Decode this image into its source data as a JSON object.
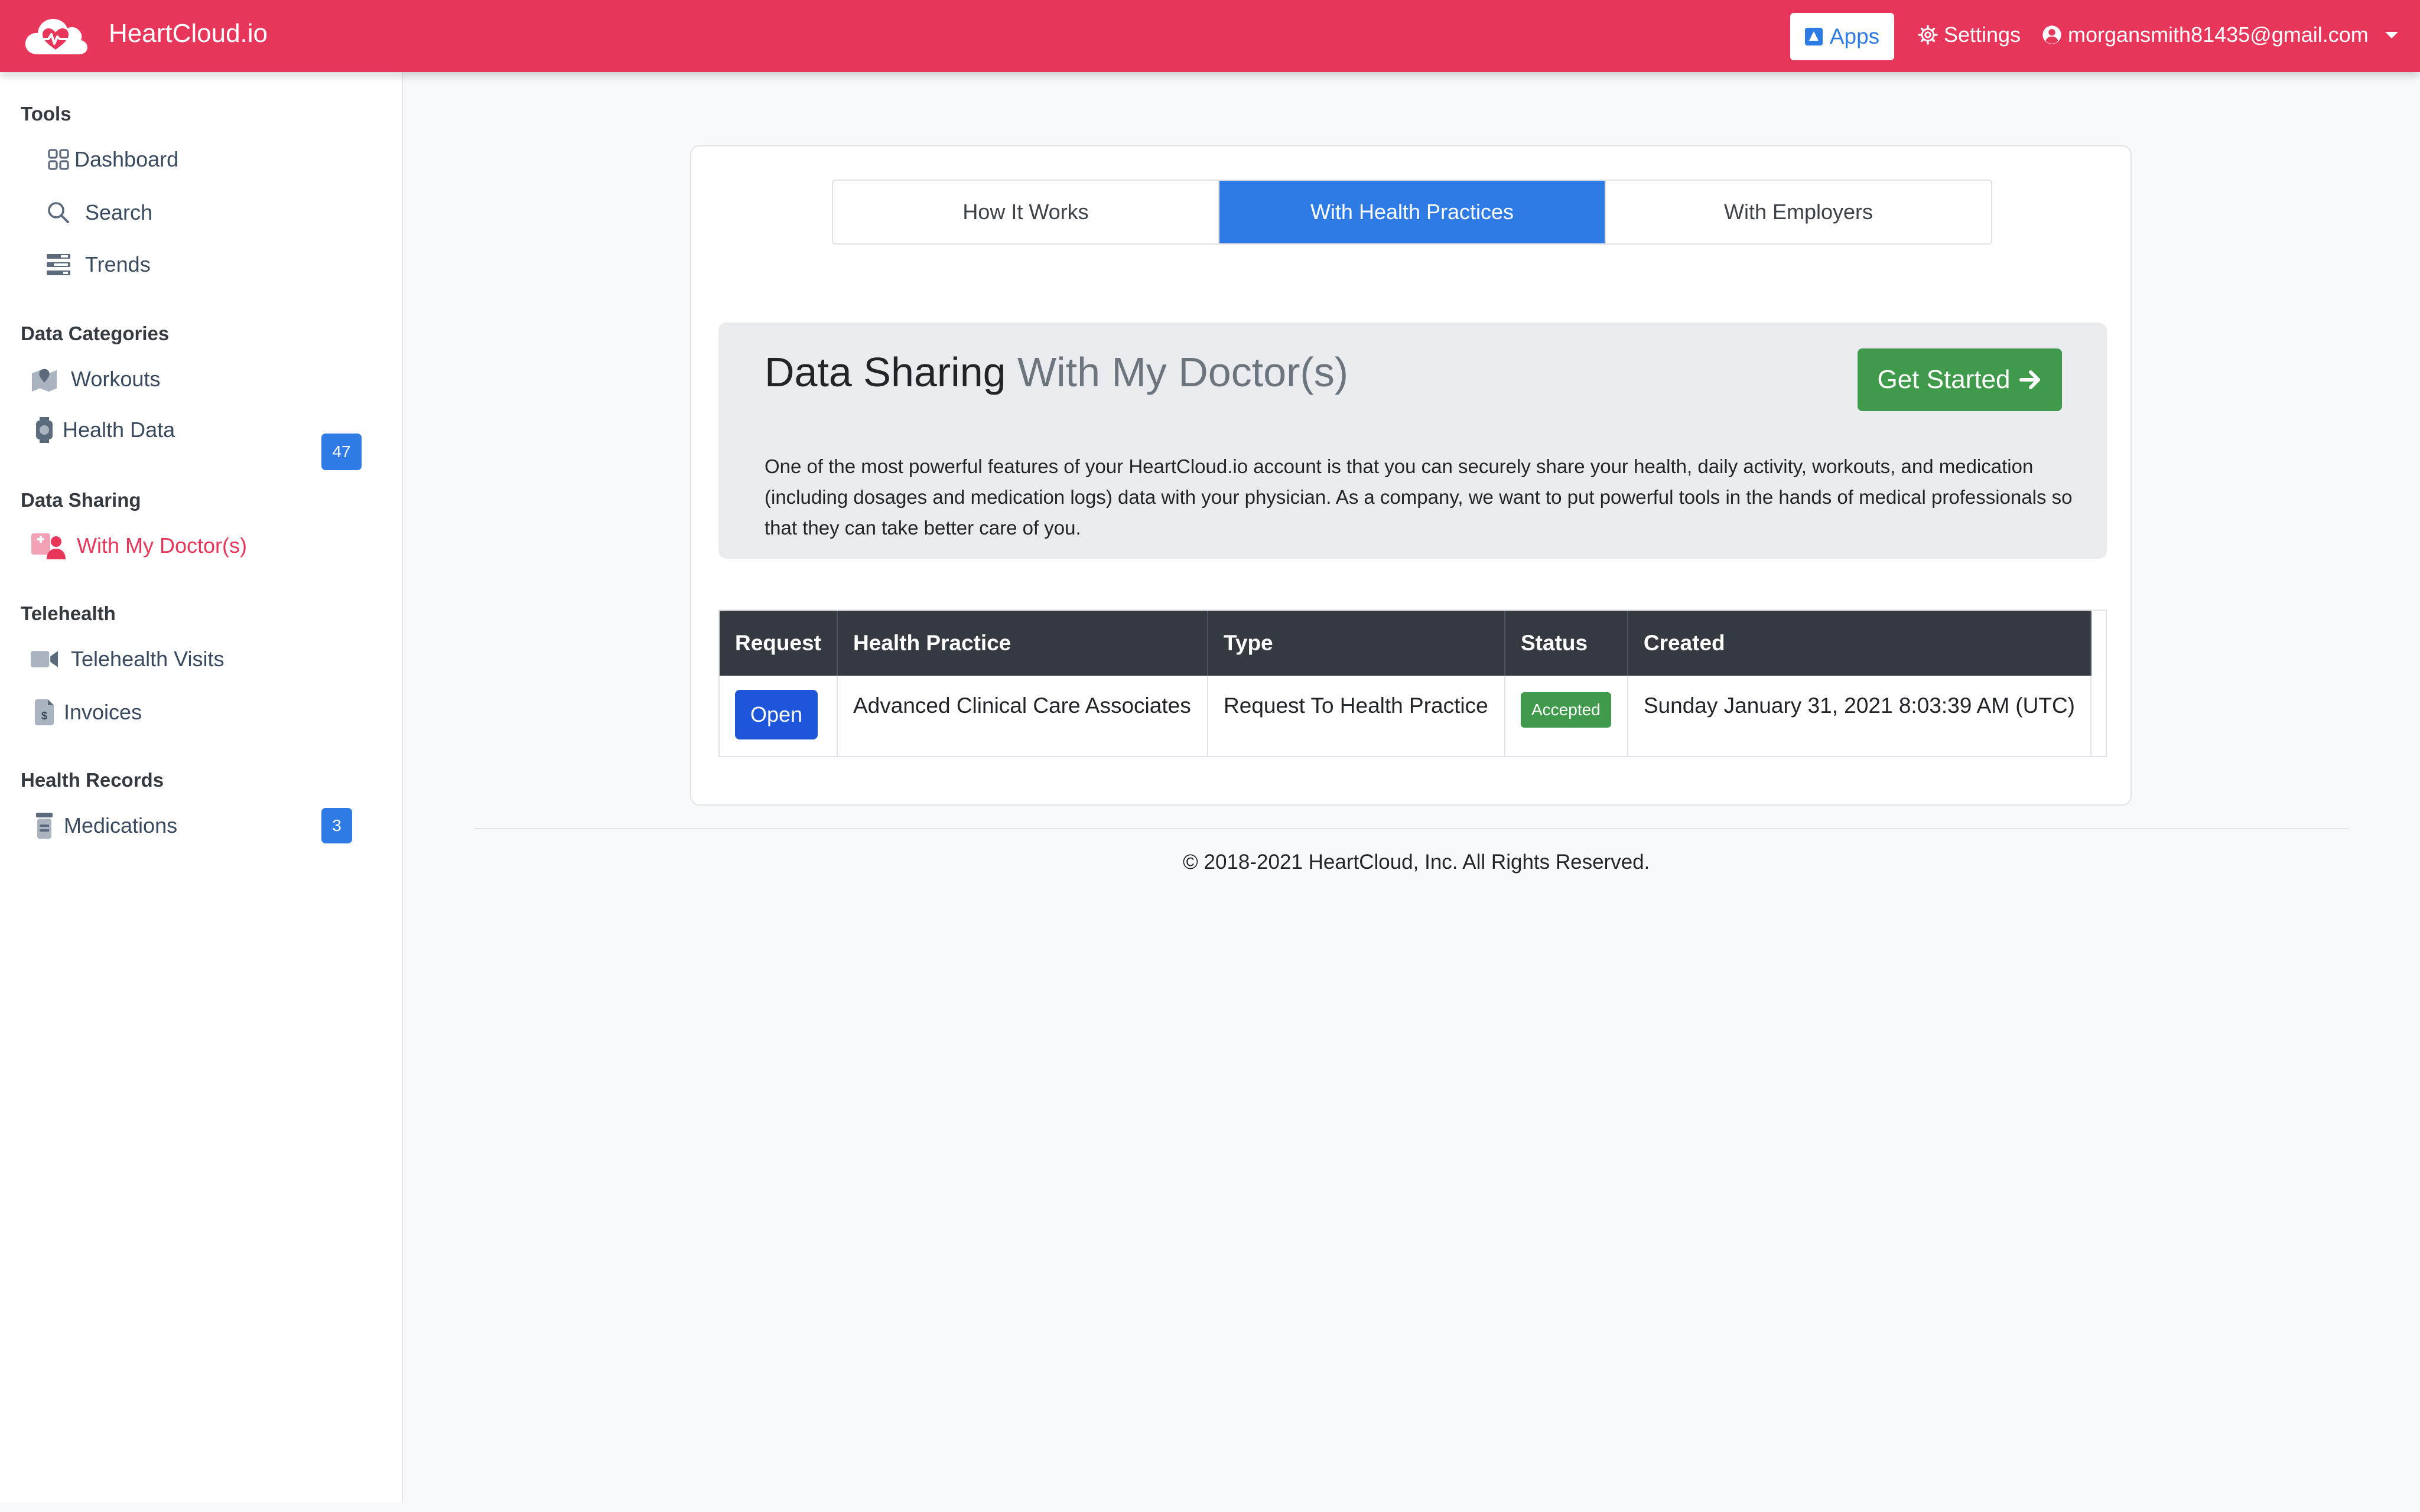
{
  "header": {
    "brand": "HeartCloud.io",
    "apps_label": "Apps",
    "settings_label": "Settings",
    "user_email": "morgansmith81435@gmail.com"
  },
  "sidebar": {
    "sections": [
      {
        "title": "Tools"
      },
      {
        "title": "Data Categories"
      },
      {
        "title": "Data Sharing"
      },
      {
        "title": "Telehealth"
      },
      {
        "title": "Health Records"
      }
    ],
    "items": [
      {
        "label": "Dashboard",
        "icon": "dashboard-icon"
      },
      {
        "label": "Search",
        "icon": "search-icon"
      },
      {
        "label": "Trends",
        "icon": "trends-icon"
      },
      {
        "label": "Workouts",
        "icon": "map-icon",
        "badge": "47"
      },
      {
        "label": "Health Data",
        "icon": "watch-icon"
      },
      {
        "label": "With My Doctor(s)",
        "icon": "doctor-icon",
        "active": true
      },
      {
        "label": "Telehealth Visits",
        "icon": "video-icon"
      },
      {
        "label": "Invoices",
        "icon": "invoice-icon"
      },
      {
        "label": "Medications",
        "icon": "medication-icon",
        "badge": "3"
      }
    ]
  },
  "tabs": [
    {
      "label": "How It Works",
      "active": false
    },
    {
      "label": "With Health Practices",
      "active": true
    },
    {
      "label": "With Employers",
      "active": false
    }
  ],
  "jumbotron": {
    "title": "Data Sharing",
    "subtitle": "With My Doctor(s)",
    "cta_label": "Get Started",
    "description": "One of the most powerful features of your HeartCloud.io account is that you can securely share your health, daily activity, workouts, and medication (including dosages and medication logs) data with your physician. As a company, we want to put powerful tools in the hands of medical professionals so that they can take better care of you."
  },
  "table": {
    "headers": [
      "Request",
      "Health Practice",
      "Type",
      "Status",
      "Created"
    ],
    "rows": [
      {
        "request_label": "Open",
        "health_practice": "Advanced Clinical Care Associates",
        "type": "Request To Health Practice",
        "status": "Accepted",
        "created": "Sunday January 31, 2021 8:03:39 AM (UTC)"
      }
    ]
  },
  "footer": {
    "text": "© 2018-2021 HeartCloud, Inc. All Rights Reserved."
  },
  "colors": {
    "brand": "#e8365a",
    "primary": "#2f7be5",
    "success": "#3f9b4b",
    "table_header": "#343a40"
  }
}
